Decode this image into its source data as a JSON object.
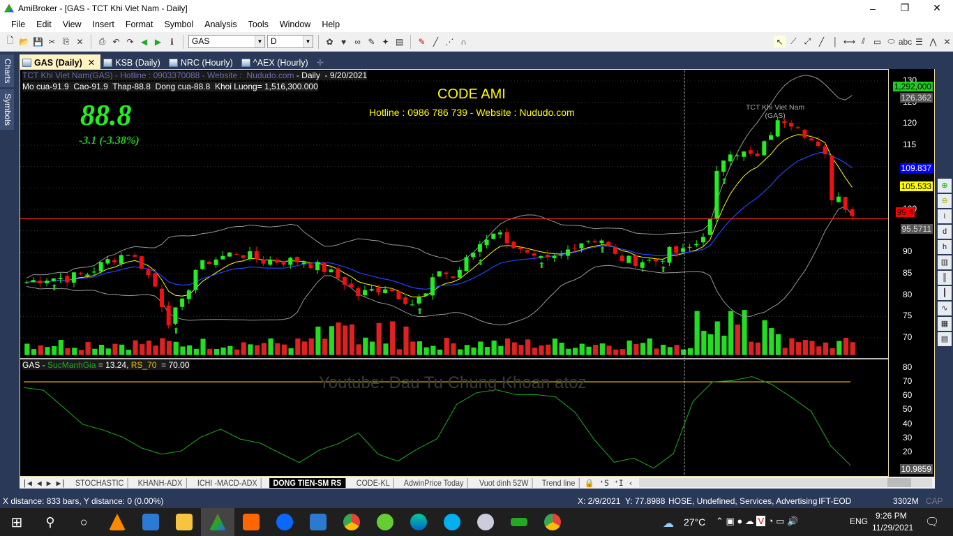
{
  "window": {
    "title": "AmiBroker - [GAS - TCT Khi Viet Nam - Daily]",
    "min": "–",
    "max": "❐",
    "close": "✕"
  },
  "menu": [
    "File",
    "Edit",
    "View",
    "Insert",
    "Format",
    "Symbol",
    "Analysis",
    "Tools",
    "Window",
    "Help"
  ],
  "toolbar": {
    "symbol": "GAS",
    "interval": "D"
  },
  "side_tabs": [
    "Charts",
    "Symbols"
  ],
  "chart_tabs": [
    {
      "label": "GAS (Daily)",
      "active": true
    },
    {
      "label": "KSB (Daily)"
    },
    {
      "label": "NRC (Hourly)"
    },
    {
      "label": "^AEX (Hourly)"
    }
  ],
  "chart": {
    "header1": "TCT Khi Viet Nam(GAS) - Hotline : 0903370088 - Website :  Nududo.com",
    "header1b": " - Daily  - 9/20/2021",
    "header2": "Mo cua-91.9  Cao-91.9  Thap-88.8  Dong cua-88.8  Khoi Luong= 1,516,300.000",
    "big_price": "88.8",
    "change": "-3.1 (-3.38%)",
    "code_title": "CODE AMI",
    "hotline": "Hotline : 0986 786 739 - Website : Nududo.com",
    "watermark_name": "TCT Khi Viet Nam\n(GAS)",
    "pane2_sym": "GAS - ",
    "pane2_ind": "SucManhGia",
    "pane2_val": " = 13.24, ",
    "pane2_rs": "RS_70",
    "pane2_rsval": "  = 70.00",
    "watermark": "Youtube: Dau Tu Chung Khoan atoz"
  },
  "chart_data": {
    "type": "line",
    "price_ticks": [
      130,
      125,
      120,
      115,
      110,
      105,
      100,
      95,
      90,
      85,
      80,
      75,
      70
    ],
    "price_ylim": [
      70,
      130
    ],
    "price_path": {
      "x": [
        0,
        3,
        6,
        9,
        12,
        15,
        17,
        19,
        21,
        23,
        25,
        27,
        29,
        31,
        33,
        35,
        38,
        41,
        44,
        47,
        49,
        51,
        53,
        55,
        57,
        59,
        61,
        63,
        65,
        67,
        69,
        71,
        73,
        75,
        77,
        79,
        81,
        83,
        85,
        87,
        89,
        91,
        93,
        95,
        97,
        99,
        101,
        102,
        103,
        104,
        106,
        108,
        110,
        111,
        112,
        114,
        116,
        118,
        119,
        120,
        121,
        122
      ],
      "close": [
        83,
        84,
        84,
        85,
        88,
        90,
        87,
        82,
        74,
        78,
        86,
        88,
        89,
        90,
        89,
        88,
        88,
        88,
        86,
        83,
        80,
        81,
        82,
        80,
        78,
        80,
        86,
        84,
        88,
        92,
        95,
        93,
        90,
        88,
        88,
        89,
        92,
        93,
        93,
        89,
        88,
        88,
        88,
        90,
        90,
        92,
        97,
        108,
        112,
        114,
        113,
        112,
        118,
        120,
        121,
        120,
        116,
        112,
        103,
        103,
        101,
        99
      ]
    },
    "hline": 97.8,
    "price_labels": [
      {
        "text": "1,292,000",
        "color": "#22cc22"
      },
      {
        "text": "126.362",
        "color": "#555555"
      },
      {
        "text": "109.837",
        "color": "#0000ff"
      },
      {
        "text": "105.533",
        "color": "#ffff00"
      },
      {
        "text": "99.4",
        "color": "#ff0000"
      },
      {
        "text": "95.5711",
        "color": "#555555"
      }
    ],
    "rs_ticks": [
      80,
      70,
      60,
      50,
      40,
      30,
      20
    ],
    "rs_ylim": [
      5,
      82
    ],
    "rs_line": [
      67,
      65,
      52,
      40,
      35,
      30,
      22,
      18,
      22,
      30,
      37,
      28,
      26,
      18,
      12,
      20,
      27,
      33,
      20,
      14,
      22,
      30,
      53,
      62,
      65,
      62,
      62,
      60,
      48,
      28,
      12,
      15,
      8,
      20,
      55,
      70,
      70,
      74,
      68,
      60,
      48,
      25,
      10
    ],
    "rs_level": 70,
    "rs_last": "10.9859"
  },
  "sheet_tabs": [
    "STOCHASTIC",
    "KHANH-ADX",
    "ICHI -MACD-ADX",
    "DONG TIEN-SM RS",
    "CODE-KL",
    "AdwinPrice Today",
    "Vuot dinh 52W",
    "Trend line"
  ],
  "active_sheet": "DONG TIEN-SM RS",
  "status": {
    "left": "X distance: 833 bars, Y distance: 0 (0.00%)",
    "x": "X: 2/9/2021",
    "y": "Y: 77.8988",
    "info": "HOSE, Undefined, Services, Advertising",
    "src": "IFT-EOD",
    "mem": "3302M",
    "cap": "CAP"
  },
  "tray": {
    "temp": "27°C",
    "lang": "ENG",
    "time": "9:26 PM",
    "date": "11/29/2021"
  }
}
